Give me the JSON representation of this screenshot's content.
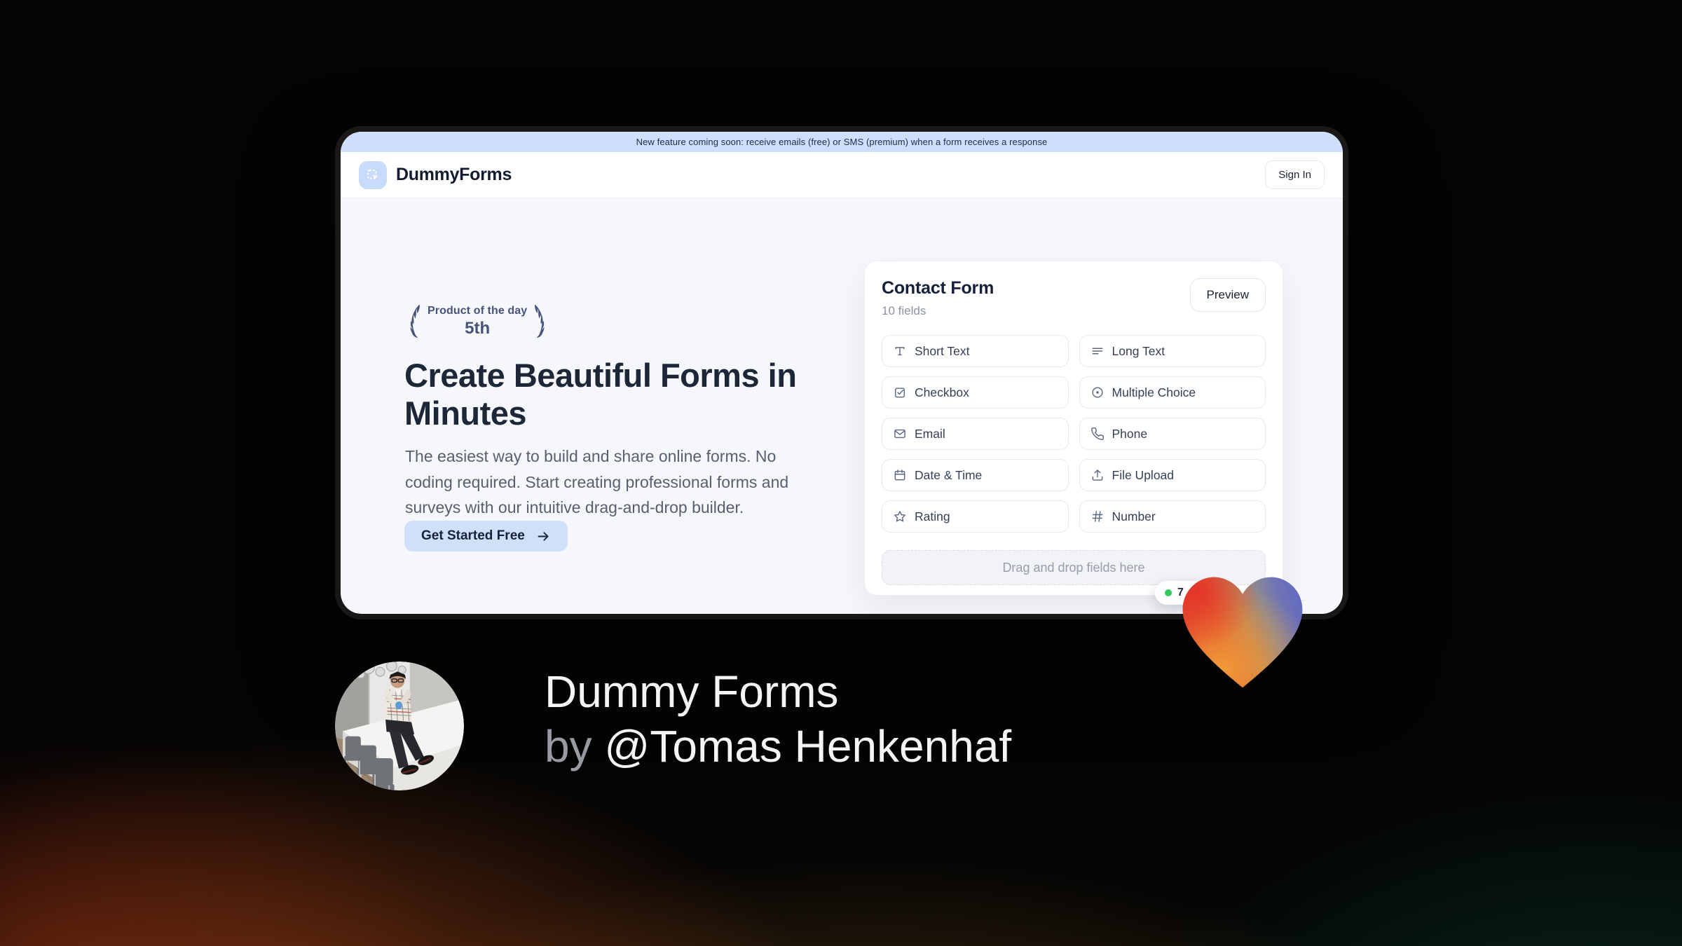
{
  "page": {
    "banner": "New feature coming soon: receive emails (free) or SMS (premium) when a form receives a response",
    "brand": "DummyForms",
    "nav": {
      "sign_in": "Sign In"
    },
    "hero": {
      "laurel_top": "Product of the day",
      "laurel_rank": "5th",
      "headline": "Create Beautiful Forms in Minutes",
      "description": "The easiest way to build and share online forms. No coding required. Start creating professional forms and surveys with our intuitive drag-and-drop builder.",
      "cta": "Get Started Free"
    },
    "builder": {
      "title": "Contact Form",
      "subtitle": "10 fields",
      "preview": "Preview",
      "fields": [
        {
          "label": "Short Text",
          "icon": "short-text-icon"
        },
        {
          "label": "Long Text",
          "icon": "long-text-icon"
        },
        {
          "label": "Checkbox",
          "icon": "checkbox-icon"
        },
        {
          "label": "Multiple Choice",
          "icon": "radio-icon"
        },
        {
          "label": "Email",
          "icon": "email-icon"
        },
        {
          "label": "Phone",
          "icon": "phone-icon"
        },
        {
          "label": "Date & Time",
          "icon": "calendar-icon"
        },
        {
          "label": "File Upload",
          "icon": "upload-icon"
        },
        {
          "label": "Rating",
          "icon": "star-icon"
        },
        {
          "label": "Number",
          "icon": "hash-icon"
        }
      ],
      "dropzone": "Drag and drop fields here",
      "status_badge": "7"
    },
    "credit": {
      "title": "Dummy Forms",
      "byline_prefix": "by ",
      "byline_handle": "@Tomas Henkenhaf"
    },
    "colors": {
      "banner_bg": "#cfdffb",
      "accent_blue": "#cfe0fb",
      "navy": "#1d2738",
      "laurel": "#47537a",
      "status_green": "#34c759",
      "heart_red": "#dd3526",
      "heart_orange": "#f29d39",
      "heart_blue": "#6469bf"
    }
  }
}
